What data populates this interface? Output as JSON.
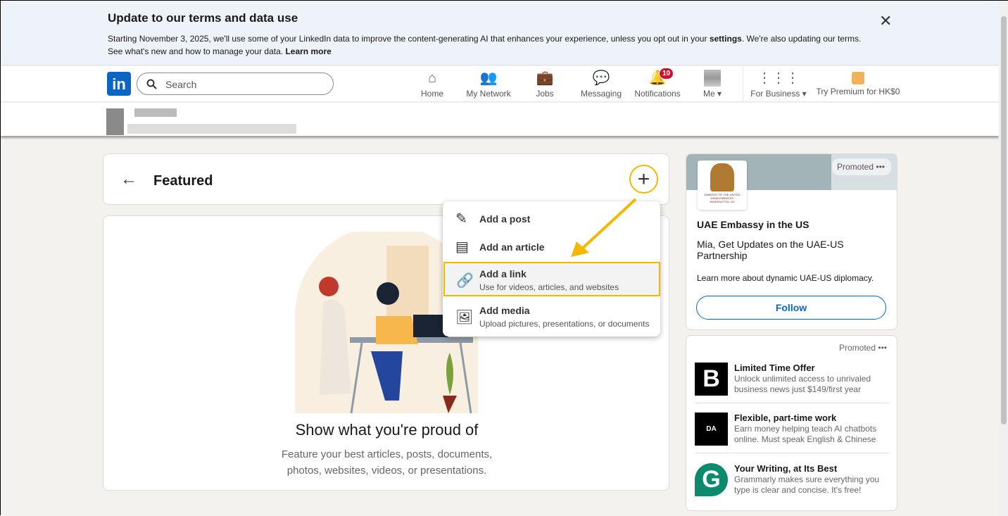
{
  "banner": {
    "title": "Update to our terms and data use",
    "line1_a": "Starting November 3, 2025, we'll use some of your LinkedIn data to improve the content-generating AI that enhances your experience, unless you opt out in your ",
    "line1_link": "settings",
    "line1_b": ". We're also updating our terms.",
    "line2": "See what's new and how to manage your data. ",
    "learn_more": "Learn more",
    "close": "✕"
  },
  "nav": {
    "logo": "in",
    "search_placeholder": "Search",
    "items": [
      {
        "label": "Home",
        "icon": "home-icon"
      },
      {
        "label": "My Network",
        "icon": "network-icon"
      },
      {
        "label": "Jobs",
        "icon": "briefcase-icon"
      },
      {
        "label": "Messaging",
        "icon": "messaging-icon"
      },
      {
        "label": "Notifications",
        "icon": "bell-icon"
      },
      {
        "label": "Me ▾",
        "icon": "avatar"
      },
      {
        "label": "For Business ▾",
        "icon": "grid-icon"
      },
      {
        "label": "Try Premium for HK$0",
        "icon": "premium-icon"
      }
    ],
    "notification_count": "10"
  },
  "featured": {
    "title": "Featured",
    "back": "←",
    "add": "+"
  },
  "empty": {
    "title": "Show what you're proud of",
    "desc1": "Feature your best articles, posts, documents,",
    "desc2": "photos, websites, videos, or presentations."
  },
  "menu": {
    "items": [
      {
        "label": "Add a post"
      },
      {
        "label": "Add an article"
      },
      {
        "label": "Add a link",
        "sub": "Use for videos, articles, and websites"
      },
      {
        "label": "Add media",
        "sub": "Upload pictures, presentations, or documents"
      }
    ]
  },
  "ad1": {
    "promoted": "Promoted",
    "more": "•••",
    "name": "UAE Embassy in the US",
    "headline": "Mia, Get Updates on the UAE-US Partnership",
    "desc": "Learn more about dynamic UAE-US diplomacy.",
    "follow": "Follow",
    "logo_text": "EMBASSY OF THE UNITED ARAB EMIRATES WASHINGTON, DC"
  },
  "ad2": {
    "promoted": "Promoted",
    "more": "•••",
    "items": [
      {
        "logo": "B",
        "title": "Limited Time Offer",
        "desc": "Unlock unlimited access to unrivaled business news just $149/first year"
      },
      {
        "logo": "DA",
        "title": "Flexible, part-time work",
        "desc": "Earn money helping teach AI chatbots online. Must speak English & Chinese"
      },
      {
        "logo": "G",
        "title": "Your Writing, at Its Best",
        "desc": "Grammarly makes sure everything you type is clear and concise. It's free!"
      }
    ]
  },
  "colors": {
    "accent": "#0a66c2",
    "highlight": "#f5b800",
    "badge": "#cb112d"
  }
}
